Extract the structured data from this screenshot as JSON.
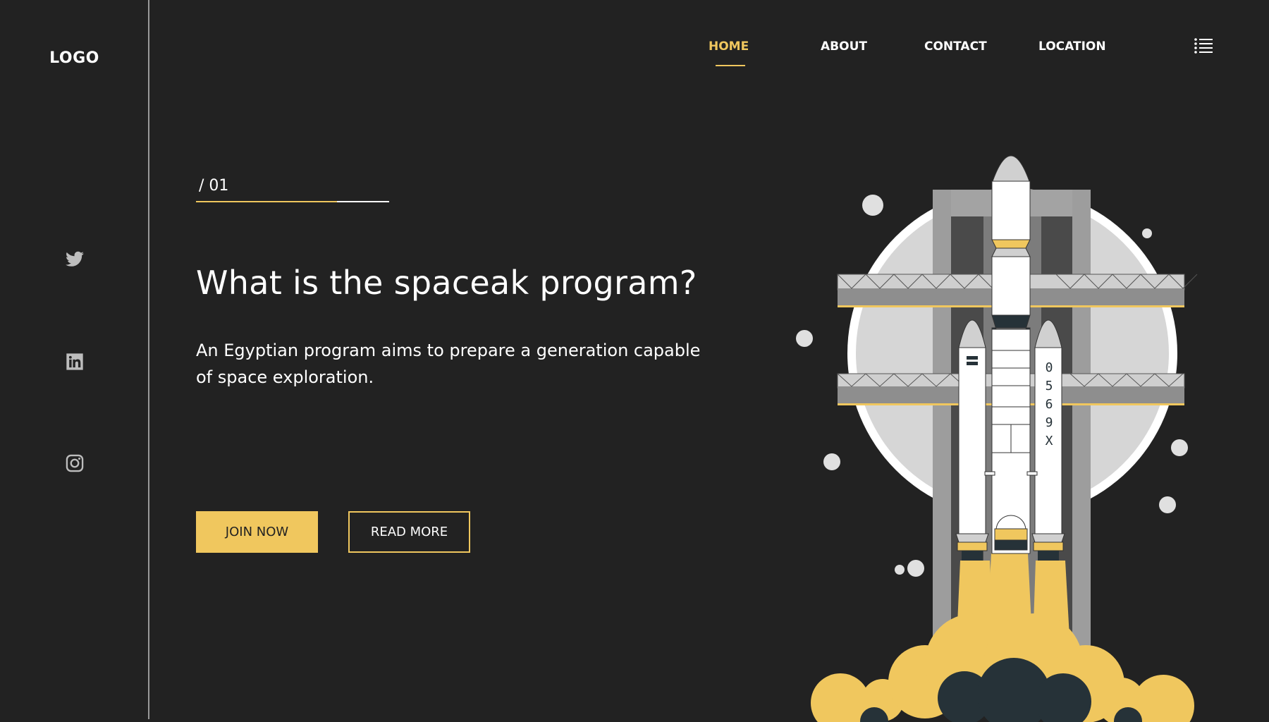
{
  "brand": {
    "logo_text": "LOGO"
  },
  "nav": {
    "items": [
      {
        "label": "HOME",
        "active": true
      },
      {
        "label": "ABOUT",
        "active": false
      },
      {
        "label": "CONTACT",
        "active": false
      },
      {
        "label": "LOCATION",
        "active": false
      }
    ]
  },
  "social": [
    "twitter-icon",
    "linkedin-icon",
    "instagram-icon"
  ],
  "hero": {
    "slide_counter": "/ 01",
    "headline": "What is the spaceak program?",
    "description": "An Egyptian program aims to prepare a generation capable of space exploration.",
    "join_label": "JOIN NOW",
    "read_label": "READ MORE"
  },
  "illustration": {
    "booster_text": [
      "0",
      "5",
      "6",
      "9",
      "X"
    ]
  },
  "colors": {
    "background": "#222222",
    "accent": "#f0c75e",
    "text": "#ffffff",
    "divider": "#9a9a9a"
  }
}
